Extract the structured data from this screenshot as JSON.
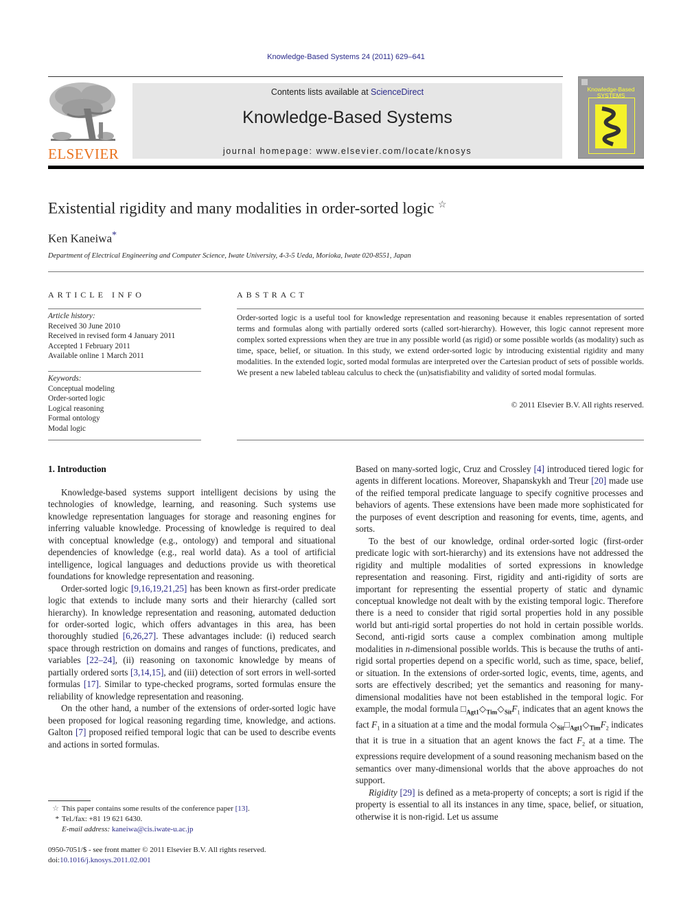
{
  "header": {
    "journal_ref": "Knowledge-Based Systems 24 (2011) 629–641",
    "contents_prefix": "Contents lists available at ",
    "contents_link": "ScienceDirect",
    "journal_title": "Knowledge-Based Systems",
    "homepage_prefix": "journal homepage: ",
    "homepage_url": "www.elsevier.com/locate/knosys",
    "publisher_logo_text": "ELSEVIER",
    "cover_title_line1": "Knowledge-Based",
    "cover_title_line2": "SYSTEMS",
    "colors": {
      "publisher_orange": "#e9711c",
      "link_blue": "#2a2a8a",
      "banner_gray": "#e6e6e6",
      "cover_yellow": "#ffff33"
    }
  },
  "article": {
    "title": "Existential rigidity and many modalities in order-sorted logic",
    "title_note_mark": "☆",
    "author": "Ken Kaneiwa",
    "author_mark": "*",
    "affiliation": "Department of Electrical Engineering and Computer Science, Iwate University, 4-3-5 Ueda, Morioka, Iwate 020-8551, Japan"
  },
  "article_info": {
    "heading": "ARTICLE INFO",
    "history_label": "Article history:",
    "history": [
      "Received 30 June 2010",
      "Received in revised form 4 January 2011",
      "Accepted 1 February 2011",
      "Available online 1 March 2011"
    ],
    "keywords_label": "Keywords:",
    "keywords": [
      "Conceptual modeling",
      "Order-sorted logic",
      "Logical reasoning",
      "Formal ontology",
      "Modal logic"
    ]
  },
  "abstract": {
    "heading": "ABSTRACT",
    "text": "Order-sorted logic is a useful tool for knowledge representation and reasoning because it enables repre­sentation of sorted terms and formulas along with partially ordered sorts (called sort-hierarchy). How­ever, this logic cannot represent more complex sorted expressions when they are true in any possible world (as rigid) or some possible worlds (as modality) such as time, space, belief, or situation. In this study, we extend order-sorted logic by introducing existential rigidity and many modalities. In the extended logic, sorted modal formulas are interpreted over the Cartesian product of sets of possible worlds. We present a new labeled tableau calculus to check the (un)satisfiability and validity of sorted modal formulas.",
    "copyright": "© 2011 Elsevier B.V. All rights reserved."
  },
  "body": {
    "section_heading": "1. Introduction",
    "col1": {
      "p1": "Knowledge-based systems support intelligent decisions by using the technologies of knowledge, learning, and reasoning. Such systems use knowledge representation languages for storage and reasoning engines for inferring valuable knowledge. Processing of knowledge is required to deal with conceptual knowledge (e.g., ontology) and temporal and situational dependencies of knowl­edge (e.g., real world data). As a tool of artificial intelligence, logical languages and deductions provide us with theoretical foundations for knowledge representation and reasoning.",
      "p2_a": "Order-sorted logic ",
      "p2_ref1": "[9,16,19,21,25]",
      "p2_b": " has been known as first-or­der predicate logic that extends to include many sorts and their hierarchy (called sort hierarchy). In knowledge representation and reasoning, automated deduction for order-sorted logic, which offers advantages in this area, has been thoroughly studied ",
      "p2_ref2": "[6,26,27]",
      "p2_c": ". These advantages include: (i) reduced search space through restriction on domains and ranges of functions, predicates, and variables ",
      "p2_ref3": "[22–24]",
      "p2_d": ", (ii) reasoning on taxonomic knowledge by means of partially ordered sorts ",
      "p2_ref4": "[3,14,15]",
      "p2_e": ", and (iii) detection of sort errors in well-sorted formulas ",
      "p2_ref5": "[17]",
      "p2_f": ". Similar to type-checked pro­grams, sorted formulas ensure the reliability of knowledge repre­sentation and reasoning.",
      "p3_a": "On the other hand, a number of the extensions of order-sorted logic have been proposed for logical reasoning regarding time, knowledge, and actions. Galton ",
      "p3_ref1": "[7]",
      "p3_b": " proposed reified temporal logic that can be used to describe events and actions in sorted formulas."
    },
    "col2": {
      "p1_a": "Based on many-sorted logic, Cruz and Crossley ",
      "p1_ref1": "[4]",
      "p1_b": " introduced tiered logic for agents in different locations. Moreover, Shapanskykh and Treur ",
      "p1_ref2": "[20]",
      "p1_c": " made use of the reified temporal predicate language to specify cognitive processes and behaviors of agents. These exten­sions have been made more sophisticated for the purposes of event description and reasoning for events, time, agents, and sorts.",
      "p2_a": "To the best of our knowledge, ordinal order-sorted logic (first-order predicate logic with sort-hierarchy) and its extensions have not addressed the rigidity and multiple modalities of sorted expres­sions in knowledge representation and reasoning. First, rigidity and anti-rigidity of sorts are important for representing the essential property of static and dynamic conceptual knowledge not dealt with by the existing temporal logic. Therefore there is a need to consider that rigid sortal properties hold in any possible world but anti-rigid sortal properties do not hold in certain possible worlds. Second, anti-rigid sorts cause a complex combination among multiple modalities in ",
      "p2_n": "n",
      "p2_b": "-dimensional possible worlds. This is because the truths of anti-rigid sortal properties depend on a spe­cific world, such as time, space, belief, or situation. In the extensions of order-sorted logic, events, time, agents, and sorts are effectively described; yet the semantics and reasoning for many-dimensional modalities have not been established in the temporal logic. For example, the modal formula ",
      "box": "□",
      "diamond": "◇",
      "sub_agt1": "Agt1",
      "sub_tim": "Tim",
      "sub_sit": "Sit",
      "F": "F",
      "one": "1",
      "two": "2",
      "p2_c": " indicates that an agent knows the fact ",
      "p2_d": " in a situation at a time and the modal formula ",
      "p2_e": " indicates that it is true in a situation that an agent knows the fact ",
      "p2_f": " at a time. The expressions require development of a sound reasoning mechanism based on the semantics over many-dimensional worlds that the above approaches do not support.",
      "p3_rigidity": "Rigidity",
      "p3_ref1": "[29]",
      "p3_a": " is defined as a meta-property of concepts; a sort is rigid if the property is essential to all its instances in any time, space, belief, or situation, otherwise it is non-rigid. Let us assume"
    }
  },
  "footnotes": {
    "fn1_mark": "☆",
    "fn1_text": "This paper contains some results of the conference paper ",
    "fn1_ref": "[13]",
    "fn1_end": ".",
    "fn2_mark": "*",
    "fn2_text": "Tel./fax: +81 19 621 6430.",
    "email_label": "E-mail address:",
    "email": "kaneiwa@cis.iwate-u.ac.jp"
  },
  "bottom_meta": {
    "issn_line": "0950-7051/$ - see front matter © 2011 Elsevier B.V. All rights reserved.",
    "doi_label": "doi:",
    "doi": "10.1016/j.knosys.2011.02.001"
  }
}
